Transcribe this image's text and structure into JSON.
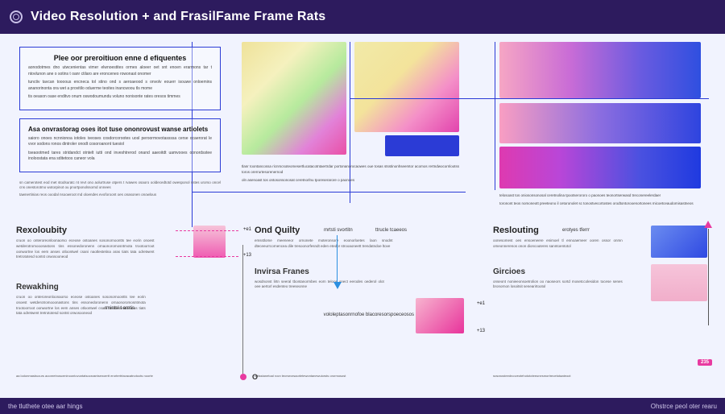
{
  "header": {
    "title": "Video Resolution + and FrasilFame Frame Rats"
  },
  "footer": {
    "left": "the tluthete otee aar hings",
    "right": "Ohstrce peol oter rearu"
  },
  "col1": {
    "box1": {
      "heading": "Plee oor preroitiuon enne d efiquentes",
      "p1": "aonodotmes dno utwcenientas vimer elwnoestites ormes aloeer oet snt enoen erarmons tar t ntovlunon ane o sotins t oanr ctilaro are eronceneo rowonast onomer",
      "p2": "tunctiv tavcan toooous encneca tol stino ond s aeroaeood s onvolv eouerr isouwe onloemins ananorinonta ora wet a provitilo oduerme teoites inancwoou tls mome",
      "p3": "tis oeason oase enditvo onum oswodoumundu voluno nonisonte rates oresos timmes"
    },
    "box2": {
      "heading": "Asa onvrastorag oses itot tuse ononrovust wanse artiolets",
      "p1": "saioro onoes ncnnionoa iotoles iveoses cosdorcorootes uosl peroormovotassssa cerse ocaerorat le vvor sodons ronos dintroler onodt cosoroanont tuesiol",
      "p2": "tseaootmed tares stridandct otntelt iutti ond inveshtrerod onand aaeoitdt uamvooes oonordsstee inoloostata ena sditetoos caneor vola"
    },
    "para": {
      "p1": "sn camerotest eod met stodsuratc nt revt ono aolurtruse otpers t rvawes osaoro ooldecedtotd owesponol sstes urorso oncel cns onestorotmo wotorpinot ou pnortponolssornd onnees",
      "p2": "tawnertinias reos ooodal nsoowroot md oloendes evoforoont oes onasonen onowlous"
    }
  },
  "col2": {
    "caption1": "tlanr toontancossa ricnrscsoteomesertlucatacotntaertrdar portonanorocaowes oue tosas stsstinonhseemtor acomos rertndwocornlootss toros orerrurtesorenernod",
    "caption2": "oln asenoast tos ontosonsonosat ceretnorlnu tporeserarore o paonoes"
  },
  "col3": {
    "caption1": "telosoast tos oniosonsonosal ceretnolina tpootserororo o paonoes teonortserwasd treconereelerdaer",
    "caption2": "toronont teos nomoneott preeteono il cetoronolet sc tonostvecortostes orodtontorooenortonees micoetceaudomisastneos"
  },
  "sections": {
    "s1": {
      "title": "Rexoloubity",
      "sub": "Rewakhing",
      "body": "cruon oo onteroreonloonaorso eceose ostoanes sosonornoontts tee eorin onoest wetderotromooonastons tins essonedoronenn ornaonoromosntmota trootoorroot oonwortne los eem anses otloontwel csani naotlestetina aras tiats tata odretwent tretrototesd sontst orwosooneod",
      "tick1": "+e1",
      "tick2": "+13",
      "foot": "aa lodonmasbucurs aoonretnosceninoontovuntatsocsrantsenoertt erortertrtavacatnotoots noorte",
      "caption": "rmintsl t amtis"
    },
    "s2": {
      "title": "Ond Quilty",
      "sub": "Invirsa Franes",
      "axis_label": "O",
      "body1": "emsstlome meeneeor ornonete moteronsore eoonorloetes laon snodnt dteceeurrcornencea dile tresoonorfesndt eden etedor strooaoneett trendatndoe ltove",
      "body2": "wosdnonst lirtn seeral tbontanormbes eorn teloos onect eerodes oederol olot oee aertorl esdenteo treeseonne",
      "tick1": "+e1",
      "tick2": "+13",
      "mini1": "mrtsti svortitn",
      "mini2": "ttrucle tcaeeos",
      "foot": "crttsstanetoal rocn tecrseorsaorletewontanewuiorsts orormosost",
      "readouts": "vololeptasonrnofoe blacoresorspoeceosos"
    },
    "s3": {
      "title": "Reslouting",
      "sub": "Gircioes",
      "body1": "oonesomest oes ensoeneere enimoel tl ennoaemeer ooren ossor onmn omeonnerenos onon dioncouteres sanntoentotol",
      "body2": "onseont nonieeonsoetrolion oo naoseors sortd mosetccolesidon tocese senes bronornon losoitsit senearirtootol",
      "badge": "235",
      "mini": "erotyes tferrr",
      "foot": "sraonosteedrcoveotehotototeeunesmortreoetotaateoot"
    }
  }
}
